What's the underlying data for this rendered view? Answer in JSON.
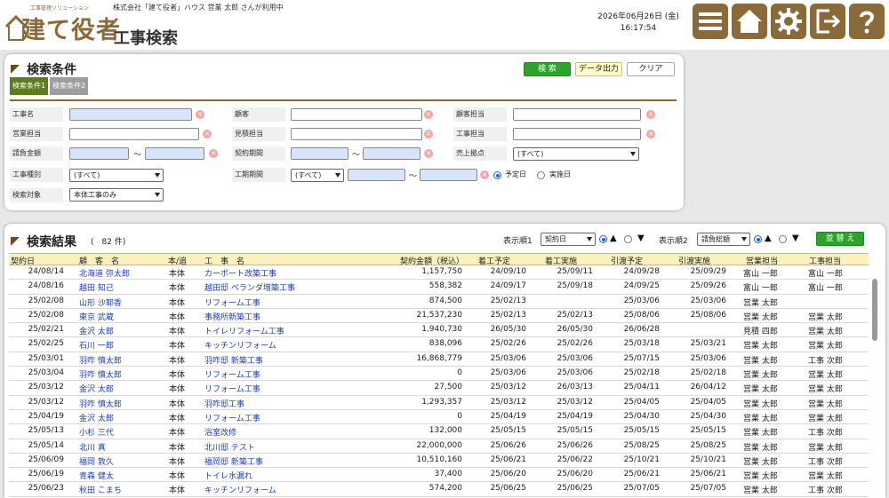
{
  "header": {
    "logo_tagline": "工事管理ソリューション",
    "logo_text": "建て役者",
    "company_user_line": "株式会社「建て役者」ハウス 営業 太郎 さんが利用中",
    "page_title": "工事検索",
    "date": "2026年06月26日 (金)",
    "time": "16:17:54",
    "buttons": [
      {
        "name": "menu",
        "icon": "menu-icon"
      },
      {
        "name": "home",
        "icon": "home-icon"
      },
      {
        "name": "settings",
        "icon": "gear-icon"
      },
      {
        "name": "logout",
        "icon": "logout-icon"
      },
      {
        "name": "help",
        "icon": "help-icon"
      }
    ],
    "accent_color": "#8b6a3a"
  },
  "conditions": {
    "title": "検索条件",
    "search_button": "検 索",
    "export_button": "データ出力",
    "clear_button": "クリア",
    "tabs": [
      "検索条件1",
      "検索条件2"
    ],
    "fields": {
      "koji_name": "工事名",
      "customer": "顧客",
      "customer_staff": "顧客担当",
      "sales_staff": "営業担当",
      "estimate_staff": "見積担当",
      "koji_staff": "工事担当",
      "contract_amount": "請負金額",
      "contract_period": "契約期間",
      "sales_base": "売上拠点",
      "sales_base_value": "(すべて)",
      "koji_type": "工事種別",
      "koji_type_value": "(すべて)",
      "koji_period": "工期期間",
      "koji_period_value": "(すべて)",
      "radio_planned": "予定日",
      "radio_actual": "実施日",
      "search_target": "検索対象",
      "search_target_value": "本体工事のみ",
      "tilde": "～"
    }
  },
  "results": {
    "title": "検索結果",
    "count_text": "(　82 件)",
    "sort1_label": "表示順1",
    "sort1_value": "契約日",
    "sort2_label": "表示順2",
    "sort2_value": "請負総額",
    "up": "▲",
    "down": "▼",
    "reorder_button": "並 替 え",
    "columns": [
      "契約日",
      "顧　客　名",
      "本/追",
      "工　事　名",
      "契約金額（税込）",
      "着工予定",
      "着工実施",
      "引渡予定",
      "引渡実施",
      "営業担当",
      "工事担当"
    ],
    "rows": [
      [
        "24/08/14",
        "北海道 弥太郎",
        "本体",
        "カーポート改築工事",
        "1,157,750",
        "24/09/10",
        "25/09/11",
        "24/09/28",
        "25/09/29",
        "富山 一郎",
        "富山 一郎"
      ],
      [
        "24/08/16",
        "越田 知己",
        "本体",
        "越田邸 ベランダ増築工事",
        "558,382",
        "24/09/17",
        "25/09/18",
        "24/09/25",
        "25/09/26",
        "富山 一郎",
        "富山 一郎"
      ],
      [
        "25/02/08",
        "山形 沙耶香",
        "本体",
        "リフォーム工事",
        "874,500",
        "25/02/13",
        "",
        "25/03/06",
        "25/03/06",
        "営業 太郎",
        ""
      ],
      [
        "25/02/08",
        "東京 武蔵",
        "本体",
        "事務所新築工事",
        "21,537,230",
        "25/02/13",
        "25/02/13",
        "25/08/06",
        "25/08/06",
        "営業 太郎",
        "営業 太郎"
      ],
      [
        "25/02/21",
        "金沢 太郎",
        "本体",
        "トイレリフォーム工事",
        "1,940,730",
        "26/05/30",
        "26/05/30",
        "26/06/28",
        "",
        "見積 四郎",
        "営業 太郎"
      ],
      [
        "25/02/25",
        "石川 一郎",
        "本体",
        "キッチンリフォーム",
        "838,096",
        "25/02/26",
        "25/02/26",
        "25/03/18",
        "25/03/21",
        "営業 太郎",
        "営業 太郎"
      ],
      [
        "25/03/01",
        "羽咋 慎太郎",
        "本体",
        "羽咋邸 新築工事",
        "16,868,779",
        "25/03/06",
        "25/03/06",
        "25/07/15",
        "25/03/06",
        "営業 太郎",
        "工事 次郎"
      ],
      [
        "25/03/04",
        "羽咋 慎太郎",
        "本体",
        "リフォーム工事",
        "0",
        "25/03/06",
        "25/03/06",
        "25/02/18",
        "25/02/18",
        "営業 太郎",
        "営業 太郎"
      ],
      [
        "25/03/12",
        "金沢 太郎",
        "本体",
        "リフォーム工事",
        "27,500",
        "25/03/12",
        "26/03/13",
        "25/04/11",
        "26/04/12",
        "営業 太郎",
        "営業 太郎"
      ],
      [
        "25/03/12",
        "羽咋 慎太郎",
        "本体",
        "羽咋邸工事",
        "1,293,357",
        "25/03/12",
        "25/03/12",
        "25/04/05",
        "25/04/05",
        "営業 太郎",
        "営業 太郎"
      ],
      [
        "25/04/19",
        "金沢 太郎",
        "本体",
        "リフォーム工事",
        "0",
        "25/04/19",
        "25/04/19",
        "25/04/30",
        "25/04/30",
        "営業 太郎",
        "営業 太郎"
      ],
      [
        "25/05/13",
        "小杉 三代",
        "本体",
        "浴室改修",
        "132,000",
        "25/05/15",
        "25/05/15",
        "25/05/15",
        "25/05/15",
        "営業 太郎",
        "工事 次郎"
      ],
      [
        "25/05/14",
        "北川 真",
        "本体",
        "北川邸 テスト",
        "22,000,000",
        "25/06/26",
        "25/06/26",
        "25/08/25",
        "25/08/25",
        "営業 太郎",
        "営業 太郎"
      ],
      [
        "25/06/09",
        "福岡 敦久",
        "本体",
        "福岡邸 新築工事",
        "10,510,160",
        "25/06/21",
        "25/06/22",
        "25/10/21",
        "25/10/21",
        "営業 太郎",
        "工事 次郎"
      ],
      [
        "25/06/19",
        "青森 健太",
        "本体",
        "トイレ水漏れ",
        "37,400",
        "25/06/20",
        "25/06/20",
        "25/06/21",
        "25/06/21",
        "営業 太郎",
        "営業 太郎"
      ],
      [
        "25/06/23",
        "秋田 こまち",
        "本体",
        "キッチンリフォーム",
        "574,200",
        "25/06/25",
        "25/06/25",
        "25/07/05",
        "25/07/05",
        "営業 太郎",
        "工事 次郎"
      ]
    ]
  }
}
